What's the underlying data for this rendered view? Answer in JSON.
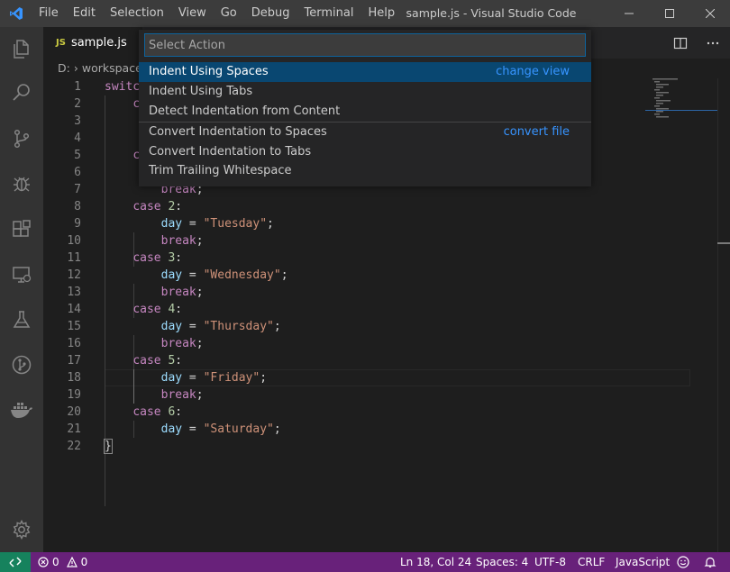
{
  "window": {
    "title": "sample.js - Visual Studio Code",
    "menu": [
      "File",
      "Edit",
      "Selection",
      "View",
      "Go",
      "Debug",
      "Terminal",
      "Help"
    ]
  },
  "activity_bar": {
    "icons": [
      "files-icon",
      "search-icon",
      "source-control-icon",
      "debug-icon",
      "extensions-icon",
      "remote-explorer-icon",
      "test-icon",
      "git-graph-icon",
      "docker-icon",
      "settings-gear-icon"
    ]
  },
  "tab": {
    "badge": "JS",
    "name": "sample.js"
  },
  "breadcrumb": {
    "drive": "D:",
    "folder": "workspace"
  },
  "quick_pick": {
    "placeholder": "Select Action",
    "items": [
      {
        "label": "Indent Using Spaces",
        "detail": "change view",
        "selected": true
      },
      {
        "label": "Indent Using Tabs",
        "detail": ""
      },
      {
        "label": "Detect Indentation from Content",
        "detail": ""
      },
      {
        "label": "Convert Indentation to Spaces",
        "detail": "convert file"
      },
      {
        "label": "Convert Indentation to Tabs",
        "detail": ""
      },
      {
        "label": "Trim Trailing Whitespace",
        "detail": ""
      }
    ]
  },
  "code": {
    "lines": [
      {
        "n": "1",
        "tokens": [
          [
            "kw",
            "switc"
          ]
        ]
      },
      {
        "n": "2",
        "tokens": [
          [
            "",
            "    "
          ],
          [
            "kw",
            "c"
          ]
        ]
      },
      {
        "n": "3",
        "tokens": []
      },
      {
        "n": "4",
        "tokens": []
      },
      {
        "n": "5",
        "tokens": [
          [
            "",
            "    "
          ],
          [
            "kw",
            "c"
          ]
        ]
      },
      {
        "n": "6",
        "tokens": []
      },
      {
        "n": "7",
        "tokens": [
          [
            "",
            "        "
          ],
          [
            "kw",
            "break"
          ],
          [
            "",
            ";"
          ]
        ]
      },
      {
        "n": "8",
        "tokens": [
          [
            "",
            "    "
          ],
          [
            "kw",
            "case"
          ],
          [
            "",
            " "
          ],
          [
            "num",
            "2"
          ],
          [
            "",
            ":"
          ]
        ]
      },
      {
        "n": "9",
        "tokens": [
          [
            "",
            "        "
          ],
          [
            "var",
            "day"
          ],
          [
            "",
            " = "
          ],
          [
            "str",
            "\"Tuesday\""
          ],
          [
            "",
            ";"
          ]
        ]
      },
      {
        "n": "10",
        "tokens": [
          [
            "",
            "        "
          ],
          [
            "kw",
            "break"
          ],
          [
            "",
            ";"
          ]
        ]
      },
      {
        "n": "11",
        "tokens": [
          [
            "",
            "    "
          ],
          [
            "kw",
            "case"
          ],
          [
            "",
            " "
          ],
          [
            "num",
            "3"
          ],
          [
            "",
            ":"
          ]
        ]
      },
      {
        "n": "12",
        "tokens": [
          [
            "",
            "        "
          ],
          [
            "var",
            "day"
          ],
          [
            "",
            " = "
          ],
          [
            "str",
            "\"Wednesday\""
          ],
          [
            "",
            ";"
          ]
        ]
      },
      {
        "n": "13",
        "tokens": [
          [
            "",
            "        "
          ],
          [
            "kw",
            "break"
          ],
          [
            "",
            ";"
          ]
        ]
      },
      {
        "n": "14",
        "tokens": [
          [
            "",
            "    "
          ],
          [
            "kw",
            "case"
          ],
          [
            "",
            " "
          ],
          [
            "num",
            "4"
          ],
          [
            "",
            ":"
          ]
        ]
      },
      {
        "n": "15",
        "tokens": [
          [
            "",
            "        "
          ],
          [
            "var",
            "day"
          ],
          [
            "",
            " = "
          ],
          [
            "str",
            "\"Thursday\""
          ],
          [
            "",
            ";"
          ]
        ]
      },
      {
        "n": "16",
        "tokens": [
          [
            "",
            "        "
          ],
          [
            "kw",
            "break"
          ],
          [
            "",
            ";"
          ]
        ]
      },
      {
        "n": "17",
        "tokens": [
          [
            "",
            "    "
          ],
          [
            "kw",
            "case"
          ],
          [
            "",
            " "
          ],
          [
            "num",
            "5"
          ],
          [
            "",
            ":"
          ]
        ]
      },
      {
        "n": "18",
        "tokens": [
          [
            "",
            "        "
          ],
          [
            "var",
            "day"
          ],
          [
            "",
            " = "
          ],
          [
            "str",
            "\"Friday\""
          ],
          [
            "",
            ";"
          ]
        ]
      },
      {
        "n": "19",
        "tokens": [
          [
            "",
            "        "
          ],
          [
            "kw",
            "break"
          ],
          [
            "",
            ";"
          ]
        ]
      },
      {
        "n": "20",
        "tokens": [
          [
            "",
            "    "
          ],
          [
            "kw",
            "case"
          ],
          [
            "",
            " "
          ],
          [
            "num",
            "6"
          ],
          [
            "",
            ":"
          ]
        ]
      },
      {
        "n": "21",
        "tokens": [
          [
            "",
            "        "
          ],
          [
            "var",
            "day"
          ],
          [
            "",
            " = "
          ],
          [
            "str",
            "\"Saturday\""
          ],
          [
            "",
            ";"
          ]
        ]
      },
      {
        "n": "22",
        "tokens": [
          [
            "",
            "}"
          ]
        ]
      }
    ]
  },
  "status_bar": {
    "errors": "0",
    "warnings": "0",
    "position": "Ln 18, Col 24",
    "indent": "Spaces: 4",
    "encoding": "UTF-8",
    "eol": "CRLF",
    "language": "JavaScript"
  },
  "colors": {
    "status_bar": "#68217a",
    "remote_indicator": "#16825d",
    "selection": "#094771",
    "accent": "#3794ff"
  }
}
